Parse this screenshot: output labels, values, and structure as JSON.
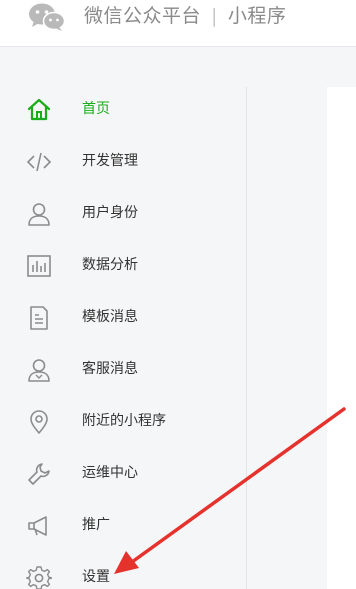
{
  "header": {
    "brand": "微信公众平台",
    "separator": "|",
    "product": "小程序"
  },
  "sidebar": {
    "items": [
      {
        "label": "首页",
        "icon": "home-icon",
        "active": true
      },
      {
        "label": "开发管理",
        "icon": "code-icon",
        "active": false
      },
      {
        "label": "用户身份",
        "icon": "user-icon",
        "active": false
      },
      {
        "label": "数据分析",
        "icon": "chart-icon",
        "active": false
      },
      {
        "label": "模板消息",
        "icon": "document-icon",
        "active": false
      },
      {
        "label": "客服消息",
        "icon": "customer-service-icon",
        "active": false
      },
      {
        "label": "附近的小程序",
        "icon": "location-pin-icon",
        "active": false
      },
      {
        "label": "运维中心",
        "icon": "wrench-icon",
        "active": false
      },
      {
        "label": "推广",
        "icon": "megaphone-icon",
        "active": false
      },
      {
        "label": "设置",
        "icon": "gear-icon",
        "active": false
      }
    ]
  },
  "colors": {
    "active": "#1aad19",
    "icon": "#8c8c8c",
    "arrow": "#e5322d"
  }
}
